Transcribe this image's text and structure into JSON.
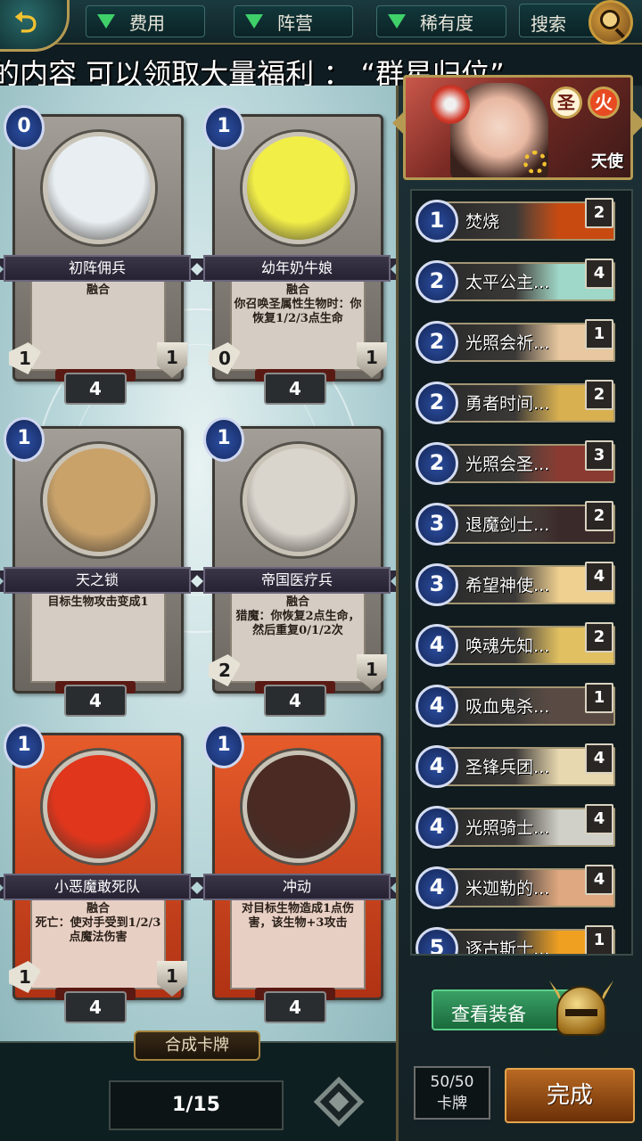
{
  "top_bar": {
    "filters": [
      {
        "label": "费用"
      },
      {
        "label": "阵营"
      },
      {
        "label": "稀有度"
      }
    ],
    "search_label": "搜索"
  },
  "marquee_text": "的内容 可以领取大量福利 ： “群星归位”",
  "cards": [
    {
      "name": "初阵佣兵",
      "cost": "0",
      "desc": "融合",
      "attack": "1",
      "health": "1",
      "count": "4",
      "style": "grey",
      "art_color": "#e8eef2"
    },
    {
      "name": "幼年奶牛娘",
      "cost": "1",
      "desc": "融合\n你召唤圣属性生物时：你恢复1/2/3点生命",
      "attack": "0",
      "health": "1",
      "count": "4",
      "style": "grey",
      "art_color": "#f2ee48"
    },
    {
      "name": "天之锁",
      "cost": "1",
      "desc": "目标生物攻击变成1",
      "attack": "",
      "health": "",
      "count": "4",
      "style": "grey",
      "art_color": "#c9a26a"
    },
    {
      "name": "帝国医疗兵",
      "cost": "1",
      "desc": "融合\n猎魔：你恢复2点生命，然后重复0/1/2次",
      "attack": "2",
      "health": "1",
      "count": "4",
      "style": "grey",
      "art_color": "#d9d4cc"
    },
    {
      "name": "小恶魔敢死队",
      "cost": "1",
      "desc": "融合\n死亡：使对手受到1/2/3点魔法伤害",
      "attack": "1",
      "health": "1",
      "count": "4",
      "style": "red",
      "art_color": "#e0361c"
    },
    {
      "name": "冲动",
      "cost": "1",
      "desc": "对目标生物造成1点伤害，该生物+3攻击",
      "attack": "",
      "health": "",
      "count": "4",
      "style": "red",
      "art_color": "#4a2a22"
    }
  ],
  "compose_label": "合成卡牌",
  "pager": "1/15",
  "hero": {
    "label": "天使",
    "elements": [
      "圣",
      "火"
    ]
  },
  "deck": [
    {
      "cost": "1",
      "name": "焚烧",
      "num": "2",
      "color": "#c84a10"
    },
    {
      "cost": "2",
      "name": "太平公主...",
      "num": "4",
      "color": "#9fd8c8"
    },
    {
      "cost": "2",
      "name": "光照会祈...",
      "num": "1",
      "color": "#e8c8a0"
    },
    {
      "cost": "2",
      "name": "勇者时间...",
      "num": "2",
      "color": "#d8b050"
    },
    {
      "cost": "2",
      "name": "光照会圣...",
      "num": "3",
      "color": "#8a3a30"
    },
    {
      "cost": "3",
      "name": "退魔剑士...",
      "num": "2",
      "color": "#3a2a2a"
    },
    {
      "cost": "3",
      "name": "希望神使...",
      "num": "4",
      "color": "#f0d090"
    },
    {
      "cost": "4",
      "name": "唤魂先知...",
      "num": "2",
      "color": "#e0c060"
    },
    {
      "cost": "4",
      "name": "吸血鬼杀...",
      "num": "1",
      "color": "#5a4a44"
    },
    {
      "cost": "4",
      "name": "圣锋兵团...",
      "num": "4",
      "color": "#e8d8b0"
    },
    {
      "cost": "4",
      "name": "光照骑士...",
      "num": "4",
      "color": "#d0d0c8"
    },
    {
      "cost": "4",
      "name": "米迦勒的...",
      "num": "4",
      "color": "#e0a880"
    },
    {
      "cost": "5",
      "name": "逐古斯士...",
      "num": "1",
      "color": "#f0a020"
    }
  ],
  "equip_label": "查看装备",
  "card_count": {
    "value": "50/50",
    "label": "卡牌"
  },
  "done_label": "完成"
}
